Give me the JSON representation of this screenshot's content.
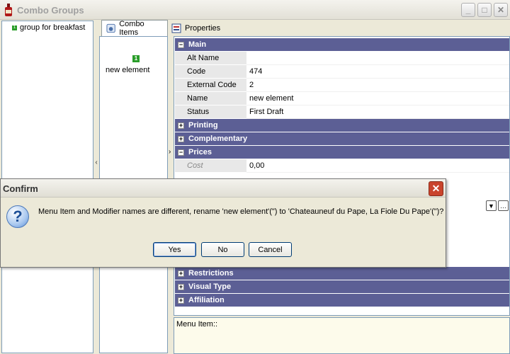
{
  "window": {
    "title": "Combo Groups",
    "minimize": "_",
    "maximize": "□",
    "close": "✕"
  },
  "tree": {
    "items": [
      {
        "label": "group for breakfast"
      }
    ]
  },
  "tabs": [
    {
      "label": "Combo Items"
    },
    {
      "label": "Properties"
    }
  ],
  "combo_items": {
    "items": [
      {
        "label": "new element"
      }
    ]
  },
  "grid": {
    "categories": {
      "main": "Main",
      "printing": "Printing",
      "complementary": "Complementary",
      "prices": "Prices",
      "restrictions": "Restrictions",
      "visual_type": "Visual Type",
      "affiliation": "Affiliation"
    },
    "main_rows": [
      {
        "name": "Alt Name",
        "value": ""
      },
      {
        "name": "Code",
        "value": "474"
      },
      {
        "name": "External Code",
        "value": "2"
      },
      {
        "name": "Name",
        "value": "new element"
      },
      {
        "name": "Status",
        "value": "First Draft"
      }
    ],
    "price_rows": [
      {
        "name": "Cost",
        "value": "0,00"
      }
    ]
  },
  "description": {
    "text": "Menu Item::"
  },
  "dialog": {
    "title": "Confirm",
    "message": "Menu Item and Modifier names are different, rename 'new element'(\") to 'Chateauneuf du Pape, La Fiole Du Pape'(\")?",
    "buttons": {
      "yes": "Yes",
      "no": "No",
      "cancel": "Cancel"
    }
  },
  "colors": {
    "category_header": "#5c5f95",
    "description_bg": "#fdfbeb"
  }
}
